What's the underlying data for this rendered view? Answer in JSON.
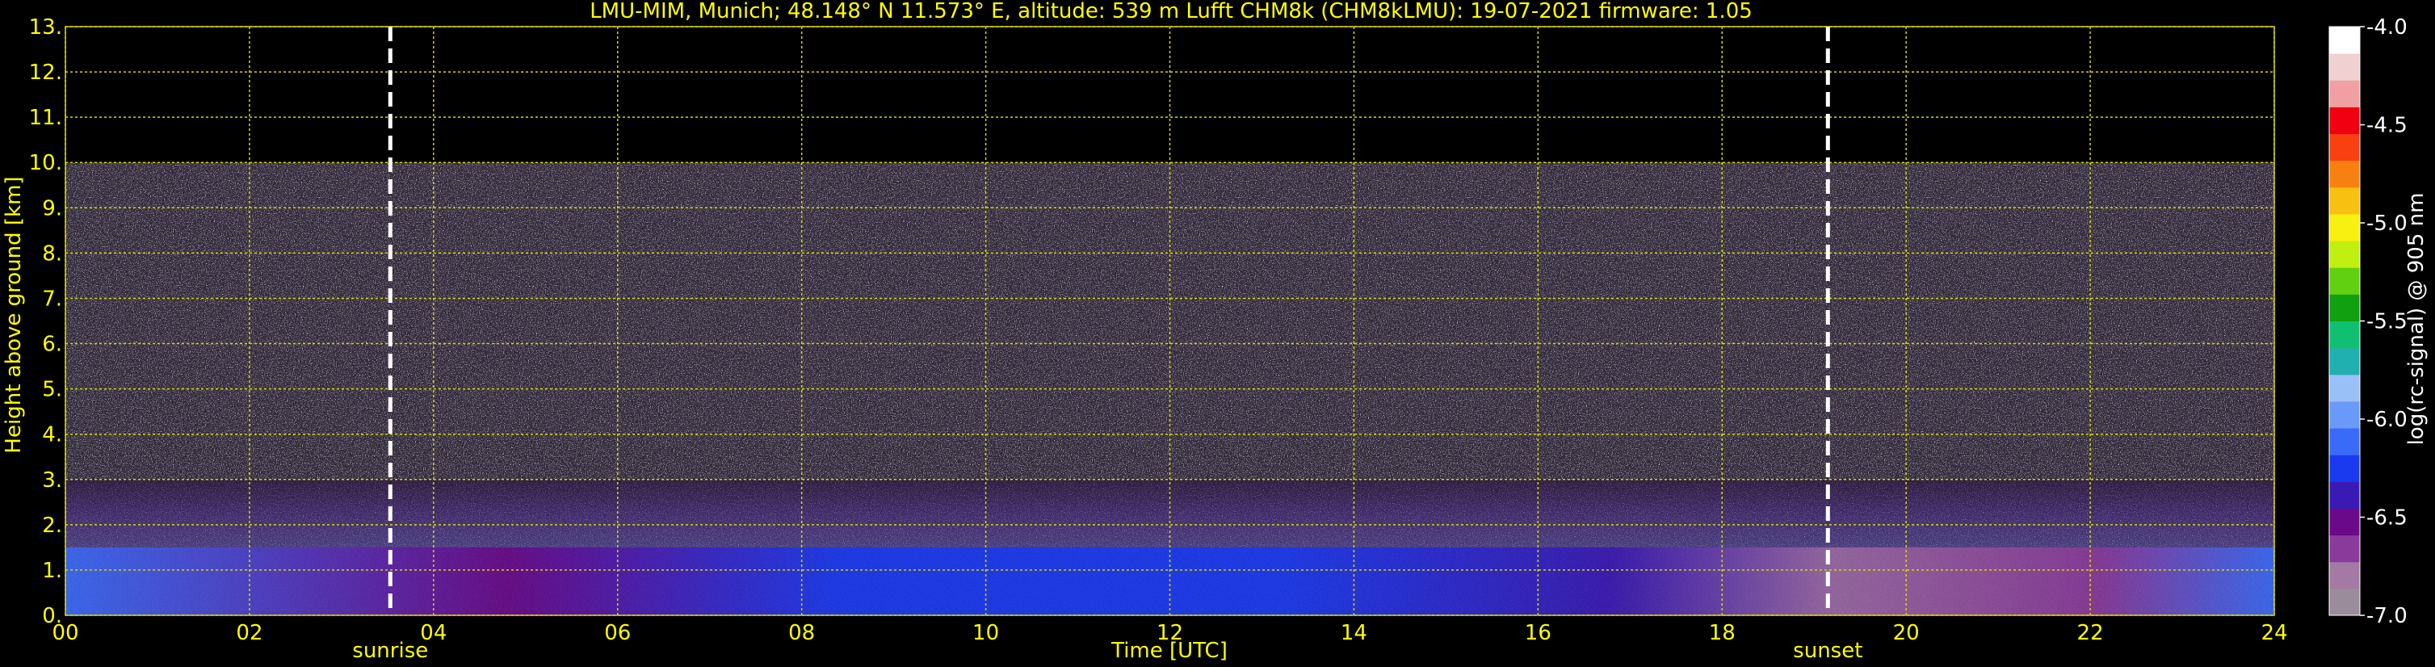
{
  "chart_data": {
    "type": "heatmap",
    "title": "LMU-MIM, Munich; 48.148° N 11.573° E, altitude: 539 m    Lufft CHM8k (CHM8kLMU): 19-07-2021    firmware: 1.05",
    "xlabel": "Time [UTC]",
    "ylabel": "Height above ground [km]",
    "colorbar_label": "log(rc-signal) @ 905 nm",
    "xlim": [
      0,
      24
    ],
    "ylim": [
      0,
      13
    ],
    "x_ticks": [
      "00",
      "02",
      "04",
      "06",
      "08",
      "10",
      "12",
      "14",
      "16",
      "18",
      "20",
      "22",
      "24"
    ],
    "y_ticks": [
      "0.",
      "1.",
      "2.",
      "3.",
      "4.",
      "5.",
      "6.",
      "7.",
      "8.",
      "9.",
      "10.",
      "11.",
      "12.",
      "13."
    ],
    "colorbar_range": [
      -7.0,
      -4.0
    ],
    "colorbar_ticks": [
      "-4.0",
      "-4.5",
      "-5.0",
      "-5.5",
      "-6.0",
      "-6.5",
      "-7.0"
    ],
    "data_top_km": 10,
    "grid": true,
    "markers": [
      {
        "label": "sunrise",
        "time": 3.53
      },
      {
        "label": "sunset",
        "time": 19.15
      }
    ],
    "colors": {
      "text": "#ffff00",
      "grid": "#d8d800",
      "marker": "#ffffff"
    },
    "colormap": [
      "#9a8c9a",
      "#a47aa4",
      "#8a3a9a",
      "#6a0a8a",
      "#3a1ab4",
      "#1a3af0",
      "#3a6af8",
      "#6a9af8",
      "#9ac0f8",
      "#20b0b0",
      "#10c070",
      "#10a010",
      "#60d010",
      "#c0f010",
      "#f8f010",
      "#f8c010",
      "#f88010",
      "#f84010",
      "#f00010",
      "#f0a0a0",
      "#f0d0d0",
      "#ffffff"
    ]
  }
}
